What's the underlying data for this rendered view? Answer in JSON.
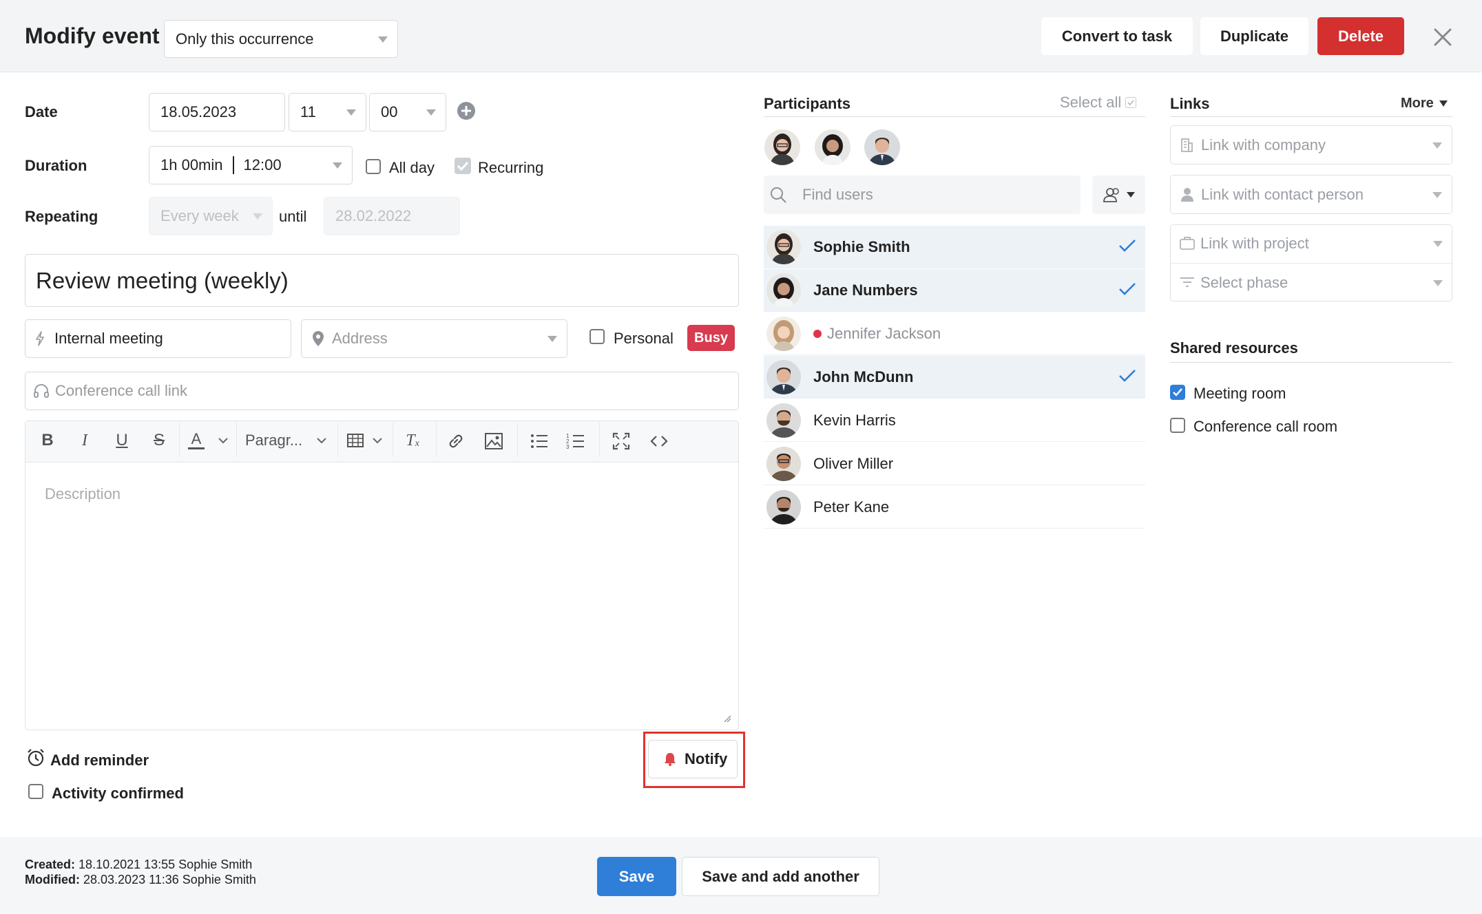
{
  "header": {
    "title": "Modify event",
    "scope_select": "Only this occurrence",
    "convert_label": "Convert to task",
    "duplicate_label": "Duplicate",
    "delete_label": "Delete"
  },
  "form": {
    "date_label": "Date",
    "date_value": "18.05.2023",
    "hour_value": "11",
    "minute_value": "00",
    "duration_label": "Duration",
    "duration_value": "1h 00min",
    "end_time": "12:00",
    "allday_label": "All day",
    "allday_checked": false,
    "recurring_label": "Recurring",
    "recurring_checked": true,
    "repeating_label": "Repeating",
    "repeat_value": "Every week",
    "until_label": "until",
    "until_value": "28.02.2022",
    "event_title": "Review meeting (weekly)",
    "event_type": "Internal meeting",
    "address_placeholder": "Address",
    "personal_label": "Personal",
    "personal_checked": false,
    "busy_badge": "Busy",
    "conference_placeholder": "Conference call link",
    "description_placeholder": "Description"
  },
  "toolbar": {
    "paragraph_label": "Paragr..."
  },
  "footer_actions": {
    "add_reminder": "Add reminder",
    "notify_label": "Notify",
    "activity_confirmed": "Activity confirmed",
    "activity_checked": false
  },
  "participants": {
    "heading": "Participants",
    "select_all": "Select all",
    "search_placeholder": "Find users",
    "list": [
      {
        "name": "Sophie Smith",
        "selected": true,
        "bold": true
      },
      {
        "name": "Jane Numbers",
        "selected": true,
        "bold": true
      },
      {
        "name": "Jennifer Jackson",
        "selected": false,
        "inactive": true
      },
      {
        "name": "John McDunn",
        "selected": true,
        "bold": true
      },
      {
        "name": "Kevin Harris",
        "selected": false
      },
      {
        "name": "Oliver Miller",
        "selected": false
      },
      {
        "name": "Peter Kane",
        "selected": false
      }
    ]
  },
  "links": {
    "heading": "Links",
    "more_label": "More",
    "company": "Link with company",
    "contact": "Link with contact person",
    "project": "Link with project",
    "phase": "Select phase"
  },
  "resources": {
    "heading": "Shared resources",
    "items": [
      {
        "label": "Meeting room",
        "checked": true
      },
      {
        "label": "Conference call room",
        "checked": false
      }
    ]
  },
  "meta": {
    "created_label": "Created:",
    "created_value": "18.10.2021 13:55 Sophie Smith",
    "modified_label": "Modified:",
    "modified_value": "28.03.2023 11:36 Sophie Smith"
  },
  "bottom": {
    "save_label": "Save",
    "save_add_label": "Save and add another"
  },
  "colors": {
    "accent_blue": "#2f7ed8",
    "delete_red": "#d3302f",
    "busy_red": "#d83a4f",
    "highlight_red": "#e0332a"
  }
}
